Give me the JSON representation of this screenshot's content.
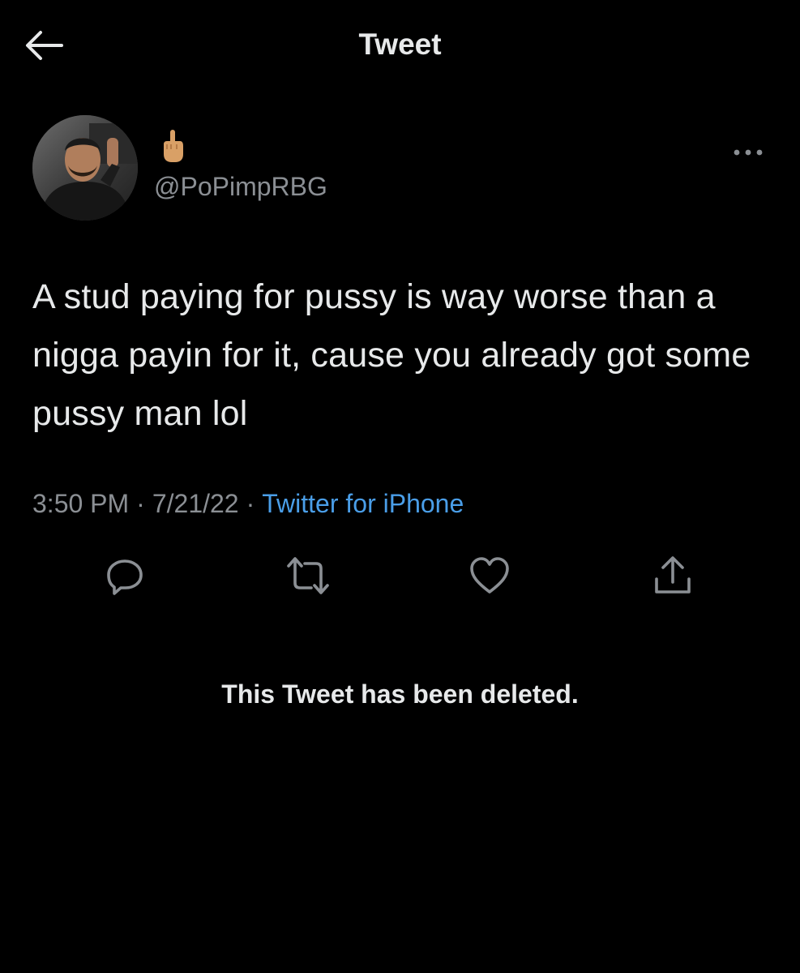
{
  "header": {
    "title": "Tweet",
    "back_icon": "arrow-left-icon"
  },
  "author": {
    "handle": "@PoPimpRBG",
    "display_name_icon": "middle-finger-emoji",
    "avatar_icon": "profile-photo",
    "more_icon": "more-horizontal-icon"
  },
  "tweet": {
    "text": "A stud paying for pussy is way worse than a nigga payin for it, cause you already got some pussy man lol",
    "time": "3:50 PM",
    "date": "7/21/22",
    "separator": "·",
    "source": "Twitter for iPhone"
  },
  "actions": {
    "reply_icon": "reply-icon",
    "retweet_icon": "retweet-icon",
    "like_icon": "heart-icon",
    "share_icon": "share-icon"
  },
  "notice": "This Tweet has been deleted.",
  "colors": {
    "background": "#000000",
    "text": "#e7e9ea",
    "secondary": "#8b8f94",
    "link": "#4a9ee8"
  }
}
